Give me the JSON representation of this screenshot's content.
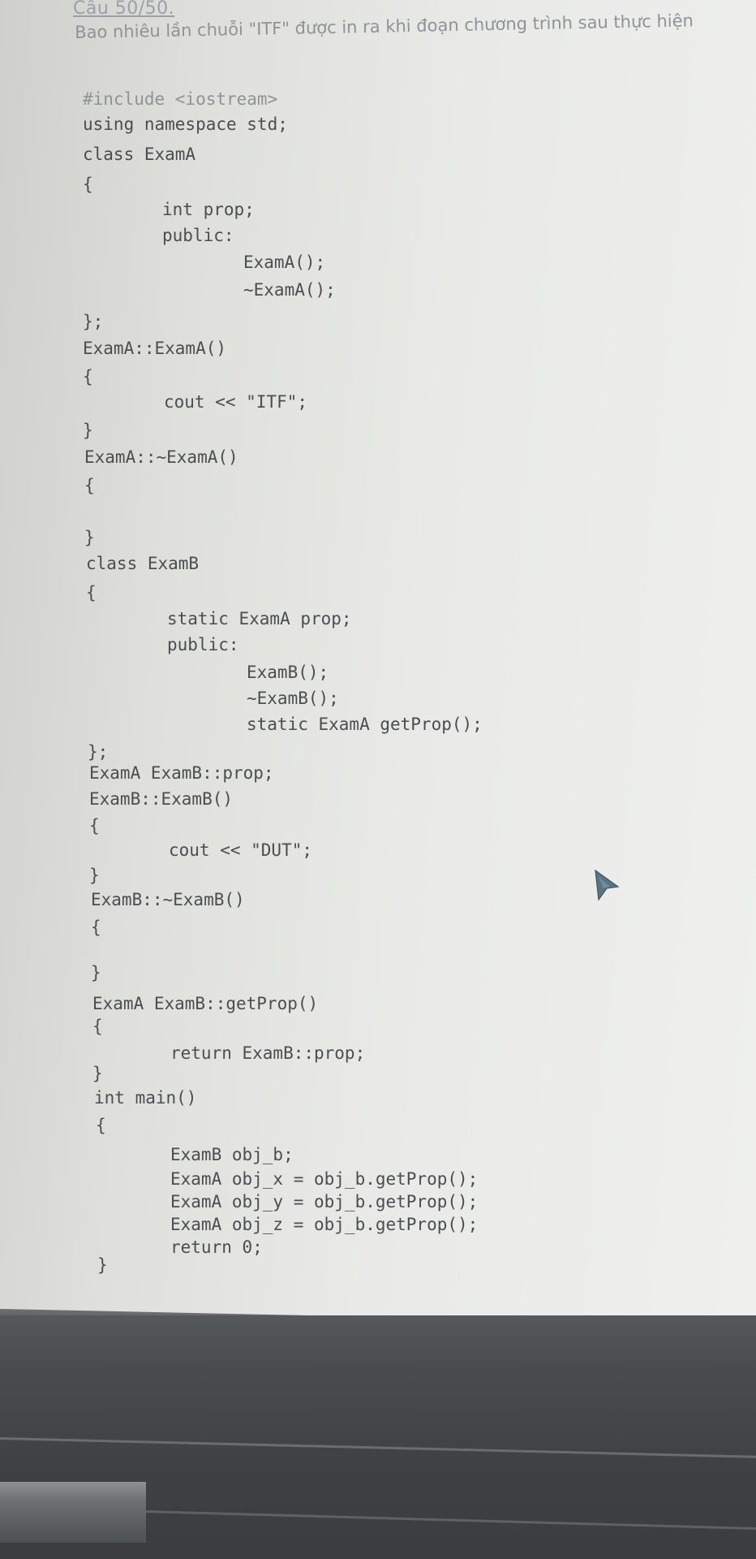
{
  "question": {
    "title": "Câu 50/50.",
    "text": "Bao nhiêu lần chuỗi \"ITF\" được in ra khi đoạn chương trình sau thực hiện"
  },
  "code_lines": [
    "#include <iostream>",
    "using namespace std;",
    "class ExamA",
    "{",
    "int prop;",
    "public:",
    "ExamA();",
    "~ExamA();",
    "};",
    "ExamA::ExamA()",
    "{",
    "cout << \"ITF\";",
    "}",
    "ExamA::~ExamA()",
    "{",
    "}",
    "class ExamB",
    "{",
    "static ExamA prop;",
    "public:",
    "ExamB();",
    "~ExamB();",
    "static ExamA getProp();",
    "};",
    "ExamA ExamB::prop;",
    "ExamB::ExamB()",
    "{",
    "cout << \"DUT\";",
    "}",
    "ExamB::~ExamB()",
    "{",
    "}",
    "ExamA ExamB::getProp()",
    "{",
    "return ExamB::prop;",
    "}",
    "int main()",
    "{",
    "ExamB obj_b;",
    "ExamA obj_x = obj_b.getProp();",
    "ExamA obj_y = obj_b.getProp();",
    "ExamA obj_z = obj_b.getProp();",
    "return 0;",
    "}"
  ],
  "icons": {
    "cursor": "mouse-pointer-icon"
  }
}
